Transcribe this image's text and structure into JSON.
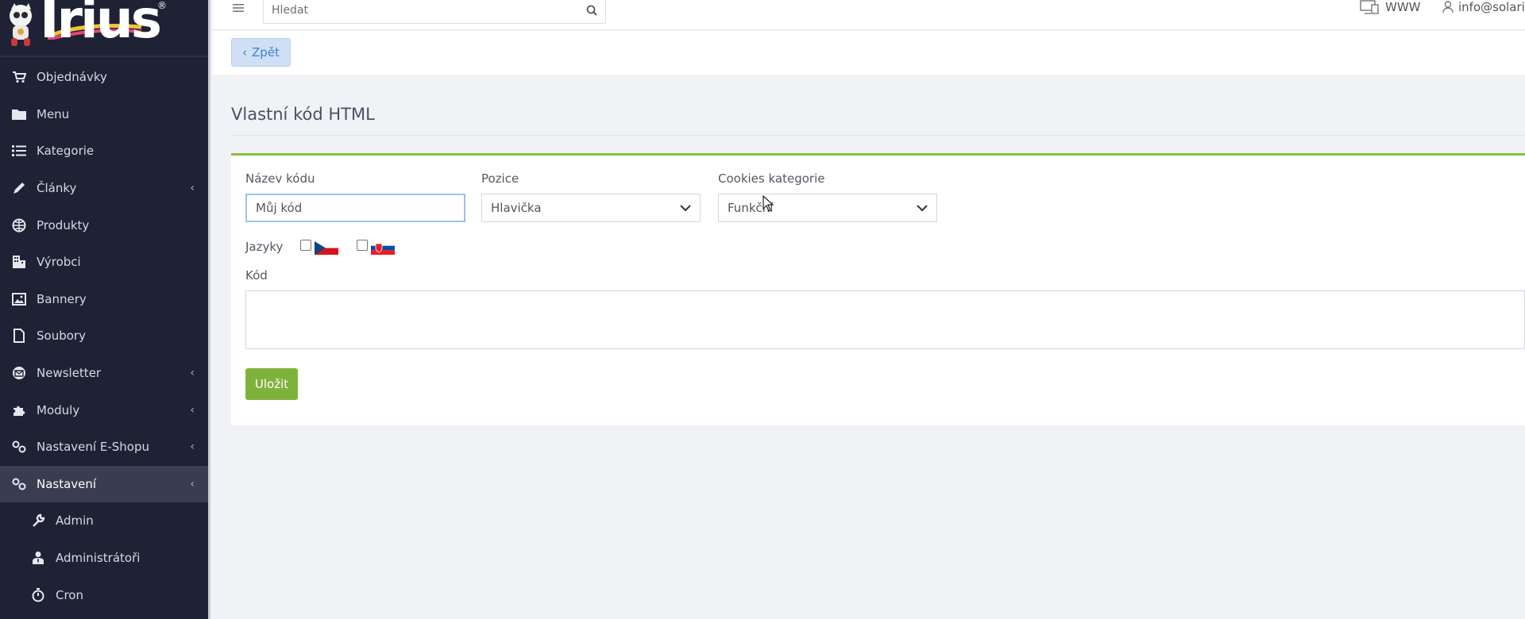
{
  "brand": {
    "logo_text": "Irius",
    "registered": "®"
  },
  "sidebar": {
    "items": [
      {
        "label": "Objednávky",
        "icon": "cart-icon",
        "chevron": false
      },
      {
        "label": "Menu",
        "icon": "folder-icon",
        "chevron": false
      },
      {
        "label": "Kategorie",
        "icon": "list-icon",
        "chevron": false
      },
      {
        "label": "Články",
        "icon": "pencil-icon",
        "chevron": true
      },
      {
        "label": "Produkty",
        "icon": "ball-icon",
        "chevron": false
      },
      {
        "label": "Výrobci",
        "icon": "building-icon",
        "chevron": false
      },
      {
        "label": "Bannery",
        "icon": "image-icon",
        "chevron": false
      },
      {
        "label": "Soubory",
        "icon": "file-icon",
        "chevron": false
      },
      {
        "label": "Newsletter",
        "icon": "mail-circle-icon",
        "chevron": true
      },
      {
        "label": "Moduly",
        "icon": "puzzle-icon",
        "chevron": true
      },
      {
        "label": "Nastavení E-Shopu",
        "icon": "gears-icon",
        "chevron": true
      },
      {
        "label": "Nastavení",
        "icon": "gears-icon",
        "chevron": true,
        "active": true
      }
    ],
    "subitems": [
      {
        "label": "Admin",
        "icon": "wrench-icon"
      },
      {
        "label": "Administrátoři",
        "icon": "user-tie-icon"
      },
      {
        "label": "Cron",
        "icon": "stopwatch-icon"
      }
    ],
    "chevron_glyph": "‹"
  },
  "topbar": {
    "search_placeholder": "Hledat",
    "www_label": "WWW",
    "user_label": "info@solari"
  },
  "back_button": {
    "label": "Zpět",
    "glyph": "‹"
  },
  "page": {
    "title": "Vlastní kód HTML"
  },
  "form": {
    "name_label": "Název kódu",
    "name_value": "Můj kód",
    "position_label": "Pozice",
    "position_value": "Hlavička",
    "cookies_label": "Cookies kategorie",
    "cookies_value": "Funkční",
    "languages_label": "Jazyky",
    "code_label": "Kód",
    "save_label": "Uložit"
  },
  "colors": {
    "sidebar_bg": "#1f2235",
    "accent_green": "#8bbf3c",
    "save_green": "#7fb23b",
    "back_blue": "#3b82d6"
  }
}
